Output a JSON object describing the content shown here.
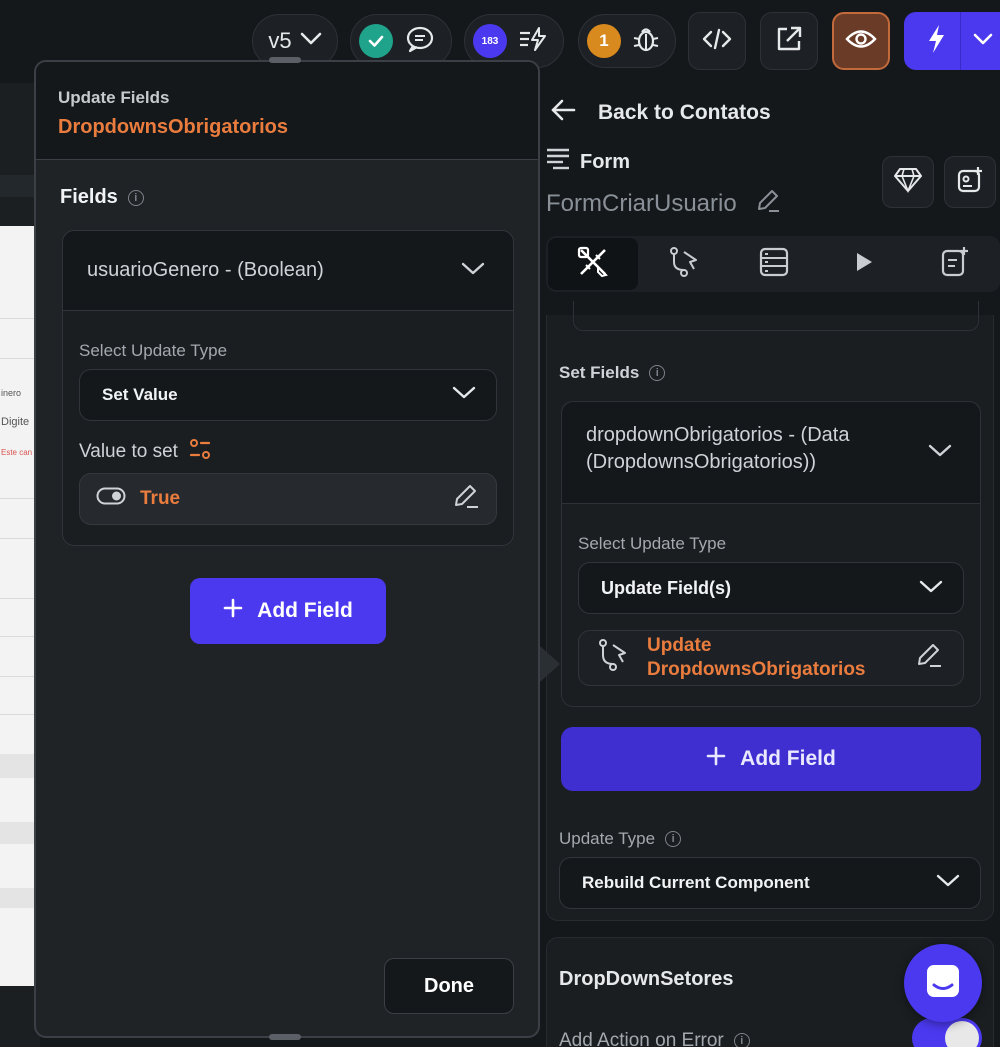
{
  "topbar": {
    "version_label": "v5",
    "comments_badge": "",
    "warnings_count": "183",
    "issues_count": "1",
    "icons": [
      "chevron-down-icon",
      "check-icon",
      "chat-icon",
      "flash-list-icon",
      "bug-icon",
      "code-icon",
      "external-link-icon",
      "eye-icon",
      "lightning-icon"
    ]
  },
  "canvas_preview": {
    "label_1": "inero",
    "label_2": "Digite",
    "label_3": "Este can"
  },
  "properties_panel": {
    "back_label": "Back to Contatos",
    "widget_type": "Form",
    "widget_name": "FormCriarUsuario",
    "set_fields_label": "Set Fields",
    "field": {
      "name": "dropdownObrigatorios - (Data (DropdownsObrigatorios))",
      "select_update_type_label": "Select Update Type",
      "update_type_value": "Update Field(s)",
      "nested_action": "Update DropdownsObrigatorios"
    },
    "add_field_label": "Add Field",
    "update_type_label": "Update Type",
    "update_type_value": "Rebuild Current Component",
    "section_title": "DropDownSetores",
    "add_action_on_error": "Add Action on Error",
    "add_action_on_error_enabled": true
  },
  "popover": {
    "subtitle": "Update Fields",
    "title": "DropdownsObrigatorios",
    "fields_label": "Fields",
    "field": {
      "name": "usuarioGenero - (Boolean)",
      "select_update_type_label": "Select Update Type",
      "update_type_value": "Set Value",
      "value_to_set_label": "Value to set",
      "value": "True"
    },
    "add_field_label": "Add Field",
    "done_label": "Done"
  },
  "colors": {
    "accent": "#4B39EF",
    "orange": "#EA7C3E",
    "success": "#1FA38A",
    "background": "#14181B",
    "surface": "#1F2326"
  }
}
